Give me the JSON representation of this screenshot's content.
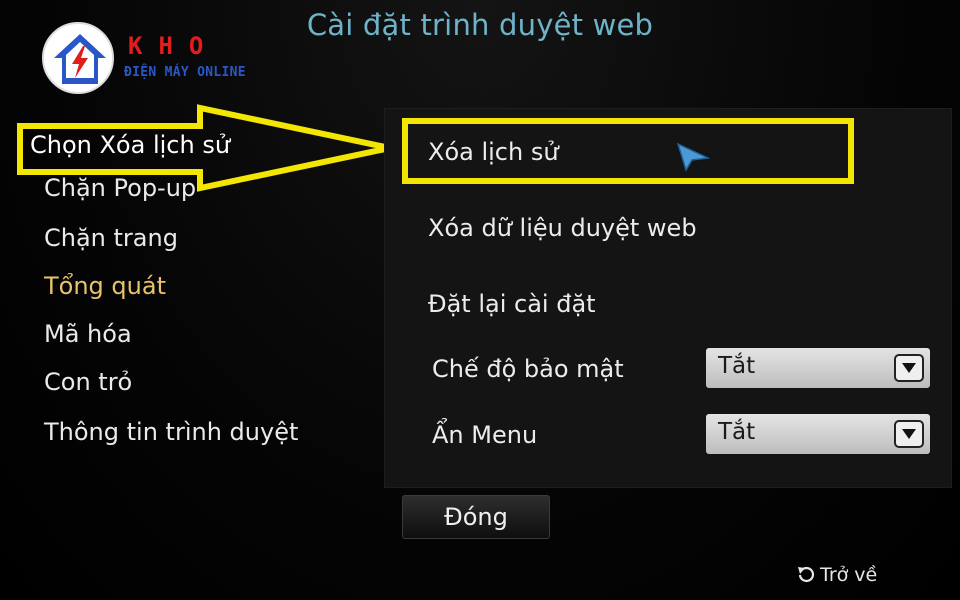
{
  "title": "Cài đặt trình duyệt web",
  "logo": {
    "main": "KHO",
    "sub": "ĐIỆN MÁY ONLINE"
  },
  "annotation": {
    "label": "Chọn Xóa lịch sử",
    "arrow_color": "#f2e602"
  },
  "left_menu": [
    {
      "label": "Chặn Pop-up"
    },
    {
      "label": "Chặn trang"
    },
    {
      "label": "Tổng quát",
      "active": true
    },
    {
      "label": "Mã hóa"
    },
    {
      "label": "Con trỏ"
    },
    {
      "label": "Thông tin trình duyệt"
    }
  ],
  "panel": {
    "clear_history": "Xóa lịch sử",
    "clear_data": "Xóa dữ liệu duyệt web",
    "reset": "Đặt lại cài đặt",
    "security_mode": {
      "label": "Chế độ bảo mật",
      "value": "Tắt"
    },
    "hide_menu": {
      "label": "Ẩn Menu",
      "value": "Tắt"
    }
  },
  "close_button": "Đóng",
  "back_label": "Trở về",
  "colors": {
    "accent_title": "#6fb3c8",
    "highlight": "#f2e602",
    "active_item": "#e8c36a"
  }
}
